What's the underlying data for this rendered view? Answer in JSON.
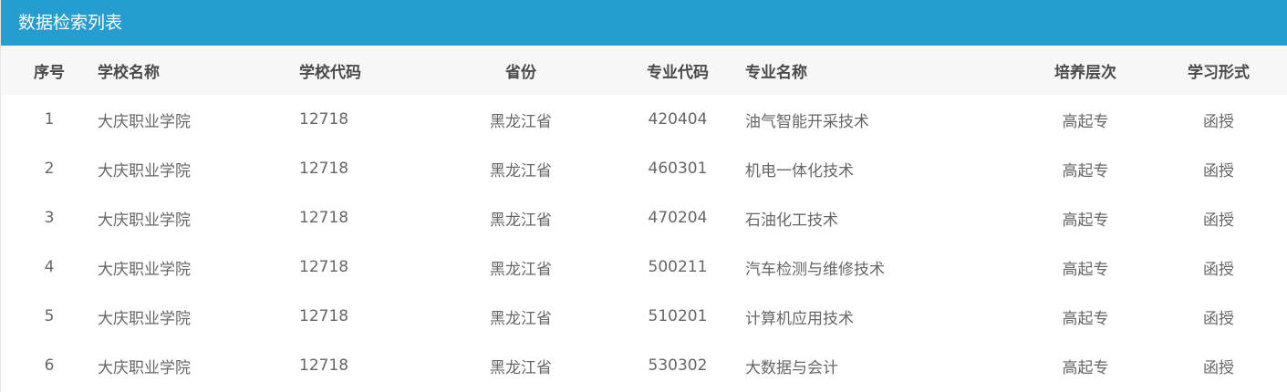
{
  "header": {
    "title": "数据检索列表",
    "bg_color": "#269dd1"
  },
  "table": {
    "columns": {
      "index": "序号",
      "school_name": "学校名称",
      "school_code": "学校代码",
      "province": "省份",
      "major_code": "专业代码",
      "major_name": "专业名称",
      "level": "培养层次",
      "study_form": "学习形式"
    },
    "rows": [
      {
        "index": "1",
        "school_name": "大庆职业学院",
        "school_code": "12718",
        "province": "黑龙江省",
        "major_code": "420404",
        "major_name": "油气智能开采技术",
        "level": "高起专",
        "study_form": "函授"
      },
      {
        "index": "2",
        "school_name": "大庆职业学院",
        "school_code": "12718",
        "province": "黑龙江省",
        "major_code": "460301",
        "major_name": "机电一体化技术",
        "level": "高起专",
        "study_form": "函授"
      },
      {
        "index": "3",
        "school_name": "大庆职业学院",
        "school_code": "12718",
        "province": "黑龙江省",
        "major_code": "470204",
        "major_name": "石油化工技术",
        "level": "高起专",
        "study_form": "函授"
      },
      {
        "index": "4",
        "school_name": "大庆职业学院",
        "school_code": "12718",
        "province": "黑龙江省",
        "major_code": "500211",
        "major_name": "汽车检测与维修技术",
        "level": "高起专",
        "study_form": "函授"
      },
      {
        "index": "5",
        "school_name": "大庆职业学院",
        "school_code": "12718",
        "province": "黑龙江省",
        "major_code": "510201",
        "major_name": "计算机应用技术",
        "level": "高起专",
        "study_form": "函授"
      },
      {
        "index": "6",
        "school_name": "大庆职业学院",
        "school_code": "12718",
        "province": "黑龙江省",
        "major_code": "530302",
        "major_name": "大数据与会计",
        "level": "高起专",
        "study_form": "函授"
      }
    ]
  }
}
